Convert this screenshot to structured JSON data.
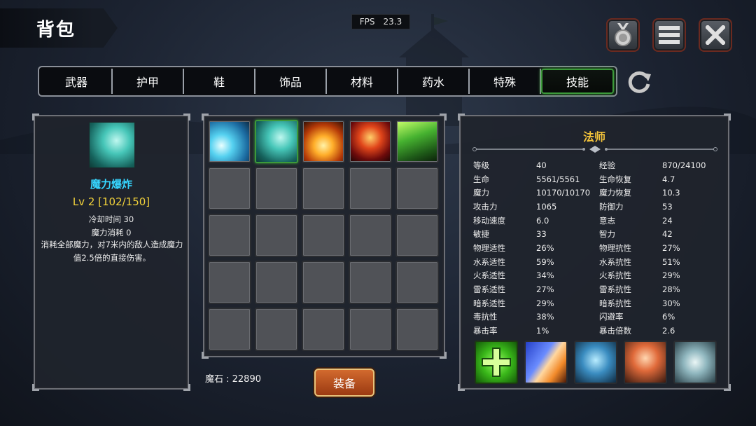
{
  "title": "背包",
  "fps": {
    "label": "FPS",
    "value": "23.3"
  },
  "tabs": [
    {
      "label": "武器"
    },
    {
      "label": "护甲"
    },
    {
      "label": "鞋"
    },
    {
      "label": "饰品"
    },
    {
      "label": "材料"
    },
    {
      "label": "药水"
    },
    {
      "label": "特殊"
    },
    {
      "label": "技能",
      "active": true
    }
  ],
  "skill_detail": {
    "name": "魔力爆炸",
    "level": "Lv 2 [102/150]",
    "cooldown": "冷却时间 30",
    "mana_cost": "魔力消耗 0",
    "description": "消耗全部魔力，对7米内的敌人造成魔力值2.5倍的直接伤害。"
  },
  "magic_stone": "魔石 : 22890",
  "equip_button": "装备",
  "class_name": "法师",
  "stats": [
    [
      "等级",
      "40",
      "经验",
      "870/24100"
    ],
    [
      "生命",
      "5561/5561",
      "生命恢复",
      "4.7"
    ],
    [
      "魔力",
      "10170/10170",
      "魔力恢复",
      "10.3"
    ],
    [
      "攻击力",
      "1065",
      "防御力",
      "53"
    ],
    [
      "移动速度",
      "6.0",
      "意志",
      "24"
    ],
    [
      "敏捷",
      "33",
      "智力",
      "42"
    ],
    [
      "物理适性",
      "26%",
      "物理抗性",
      "27%"
    ],
    [
      "水系适性",
      "59%",
      "水系抗性",
      "51%"
    ],
    [
      "火系适性",
      "34%",
      "火系抗性",
      "29%"
    ],
    [
      "雷系适性",
      "27%",
      "雷系抗性",
      "28%"
    ],
    [
      "暗系适性",
      "29%",
      "暗系抗性",
      "30%"
    ],
    [
      "毒抗性",
      "38%",
      "闪避率",
      "6%"
    ],
    [
      "暴击率",
      "1%",
      "暴击倍数",
      "2.6"
    ]
  ],
  "colors": {
    "skill_name": "#36d6ff",
    "skill_level": "#f2d23a",
    "class_name": "#f2c23a",
    "active_tab": "#3c9a3a"
  }
}
